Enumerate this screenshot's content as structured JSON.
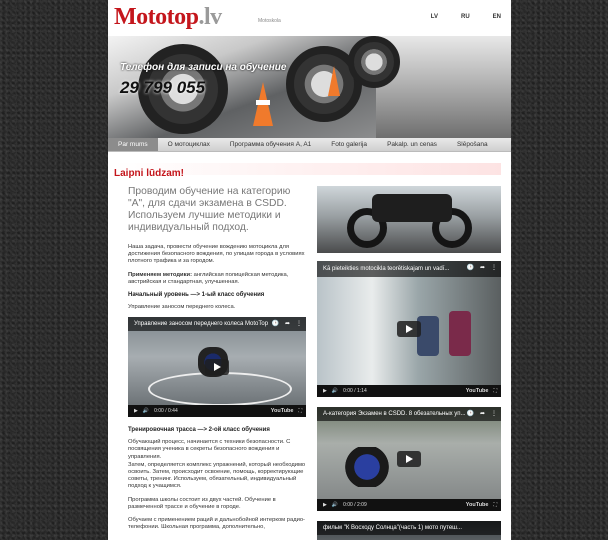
{
  "header": {
    "logo_main": "Mototop",
    "logo_tld": ".lv",
    "logo_sub": "Motoskola",
    "languages": [
      "LV",
      "RU",
      "EN"
    ]
  },
  "banner": {
    "phone_label": "Телефон для записи на обучение",
    "phone_number": "29 799 055"
  },
  "nav": {
    "items": [
      "Par mums",
      "O мотоциклах",
      "Программа обучения A, A1",
      "Foto galerija",
      "Pakalp. un cenas",
      "Slēpošana"
    ],
    "active_index": 0
  },
  "welcome": "Laipni lūdzam!",
  "left": {
    "intro": "Проводим обучение на категорию \"A\", для сдачи экзамена в CSDD. Используем лучшие методики и индивидуальный подход.",
    "p1": "Наша задача, провести обучение вождению мотоцикла для достижения безопасного вождения, по улицам города в условиях плотного трафика и за городом.",
    "p2_label": "Применяем методики:",
    "p2_text": " английская полицейская методика, австрийская и стандартная, улучшенная.",
    "h1": "Начальный уровень —> 1-ый класс обучения",
    "p3": "Управление заносом переднего колеса.",
    "video1_title": "Управление заносом переднего колеса MotoTop",
    "video1_time": "0:00 / 0:44",
    "h2": "Тренировочная трасса —> 2-ой класс обучения",
    "p4": "Обучающий процесс, начинается с техники безопасности. С посвящения ученика в секреты безопасного вождения и управления.",
    "p5": "Затем, определяется комплекс упражнений, который необходимо освоить. Затем, происходит освоение, помощь, корректирующие советы, тренинг. Используем, обязательный, индивидуальный подход к учащимся.",
    "p6": "Программа школы состоит из двух частей. Обучение в размеченной трассе и обучение в городе.",
    "p7": "Обучаем с применением раций и дальнобойной интерком радио-телефонии. Школьная программа, дополнительно,"
  },
  "right": {
    "video2_title": "Kā pieteikties motocikla teorētiskajam un vadī...",
    "video2_time": "0:00 / 1:14",
    "video3_title": "A-категория Экзамен в CSDD. 8 обезательных уп...",
    "video3_time": "0:00 / 2:09",
    "video4_title": "фильм \"К Восходу Солнца\"(часть 1) мото путеш..."
  },
  "youtube_label": "YouTube",
  "colors": {
    "brand_red": "#c4161c",
    "nav_active": "#8c8c8c"
  }
}
